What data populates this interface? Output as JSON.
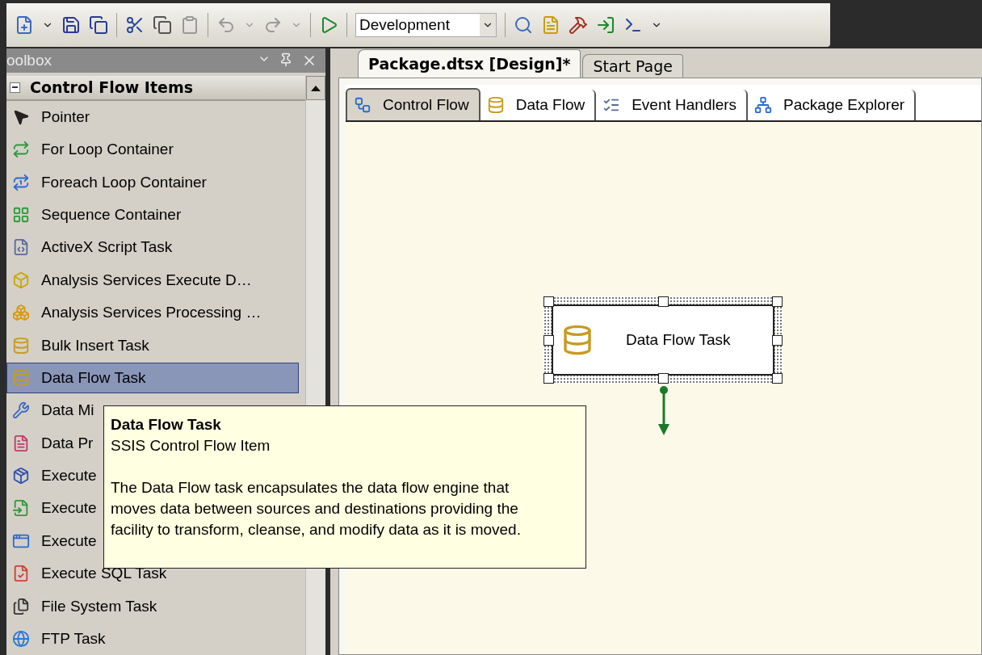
{
  "toolbar": {
    "configuration": "Development"
  },
  "toolbox": {
    "title": "oolbox",
    "group": {
      "title": "Control Flow Items",
      "expanded": true
    },
    "items": [
      {
        "label": "Pointer",
        "selected": false
      },
      {
        "label": "For Loop Container",
        "selected": false
      },
      {
        "label": "Foreach Loop Container",
        "selected": false
      },
      {
        "label": "Sequence Container",
        "selected": false
      },
      {
        "label": "ActiveX Script Task",
        "selected": false
      },
      {
        "label": "Analysis Services Execute D…",
        "selected": false
      },
      {
        "label": "Analysis Services Processing …",
        "selected": false
      },
      {
        "label": "Bulk Insert Task",
        "selected": false
      },
      {
        "label": "Data Flow Task",
        "selected": true
      },
      {
        "label": "Data Mi",
        "selected": false
      },
      {
        "label": "Data Pr",
        "selected": false
      },
      {
        "label": "Execute",
        "selected": false
      },
      {
        "label": "Execute",
        "selected": false
      },
      {
        "label": "Execute",
        "selected": false
      },
      {
        "label": "Execute SQL Task",
        "selected": false
      },
      {
        "label": "File System Task",
        "selected": false
      },
      {
        "label": "FTP Task",
        "selected": false
      }
    ]
  },
  "document_tabs": [
    {
      "label": "Package.dtsx [Design]*",
      "selected": true
    },
    {
      "label": "Start Page",
      "selected": false
    }
  ],
  "designer_tabs": [
    {
      "label": "Control Flow",
      "selected": true
    },
    {
      "label": "Data Flow",
      "selected": false
    },
    {
      "label": "Event Handlers",
      "selected": false
    },
    {
      "label": "Package Explorer",
      "selected": false
    }
  ],
  "canvas": {
    "task": {
      "label": "Data Flow Task",
      "selected": true
    }
  },
  "tooltip": {
    "title": "Data Flow Task",
    "subtitle": "SSIS Control Flow Item",
    "description": "The Data Flow task encapsulates the data flow engine that moves data between sources and destinations providing the facility to transform, cleanse, and modify data as it is moved."
  }
}
